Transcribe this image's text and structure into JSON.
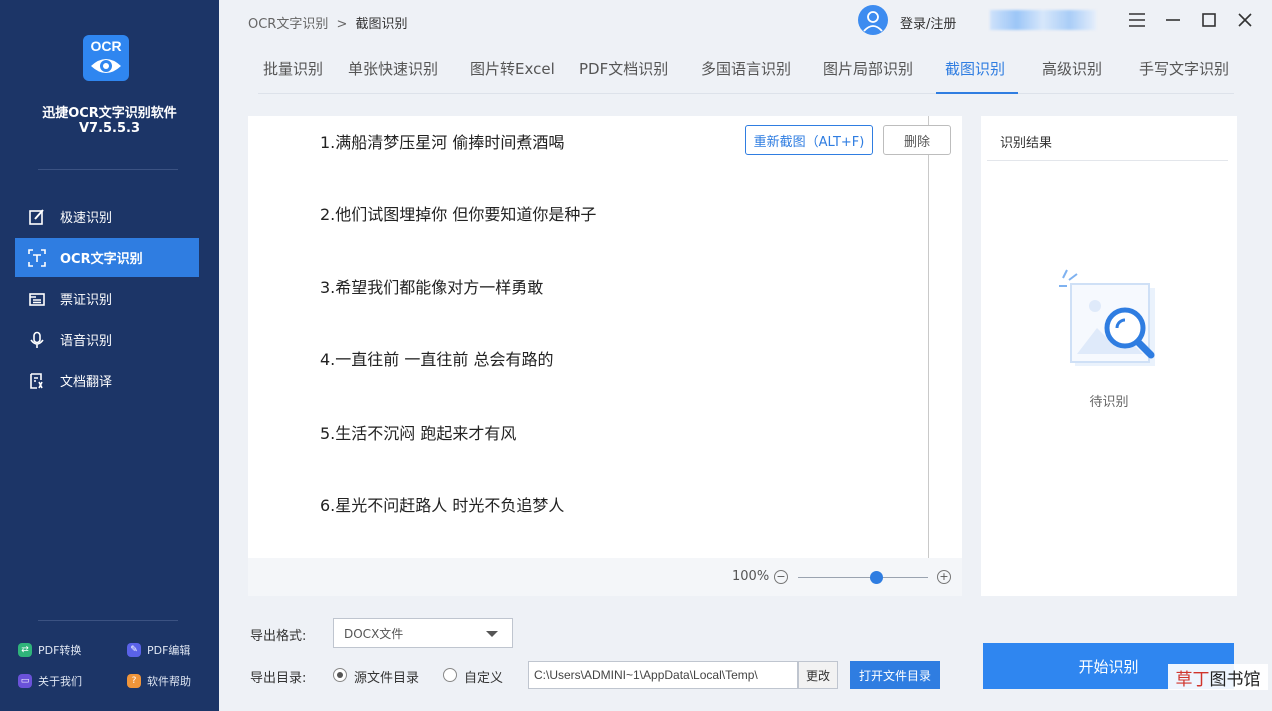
{
  "app": {
    "logo_text": "OCR",
    "name": "迅捷OCR文字识别软件",
    "version": "V7.5.5.3"
  },
  "sidebar": {
    "items": [
      {
        "label": "极速识别",
        "icon": "edit-icon"
      },
      {
        "label": "OCR文字识别",
        "icon": "scan-icon",
        "active": true
      },
      {
        "label": "票证识别",
        "icon": "id-card-icon"
      },
      {
        "label": "语音识别",
        "icon": "microphone-icon"
      },
      {
        "label": "文档翻译",
        "icon": "translate-icon"
      }
    ],
    "footer": [
      {
        "label": "PDF转换",
        "icon": "pdf-convert-icon",
        "color": "#2fb47a"
      },
      {
        "label": "PDF编辑",
        "icon": "pdf-edit-icon",
        "color": "#5a62e8"
      },
      {
        "label": "关于我们",
        "icon": "about-icon",
        "color": "#6a52d9"
      },
      {
        "label": "软件帮助",
        "icon": "help-icon",
        "color": "#f0953a"
      }
    ]
  },
  "breadcrumb": {
    "parent": "OCR文字识别",
    "separator": ">",
    "current": "截图识别"
  },
  "header": {
    "login_label": "登录/注册"
  },
  "tabs": [
    {
      "label": "批量识别"
    },
    {
      "label": "单张快速识别"
    },
    {
      "label": "图片转Excel"
    },
    {
      "label": "PDF文档识别"
    },
    {
      "label": "多国语言识别"
    },
    {
      "label": "图片局部识别"
    },
    {
      "label": "截图识别",
      "active": true
    },
    {
      "label": "高级识别"
    },
    {
      "label": "手写文字识别"
    }
  ],
  "image_panel": {
    "lines": [
      "1.满船清梦压星河 偷捧时间煮酒喝",
      "2.他们试图埋掉你 但你要知道你是种子",
      "3.希望我们都能像对方一样勇敢",
      "4.一直往前 一直往前 总会有路的",
      "5.生活不沉闷 跑起来才有风",
      "6.星光不问赶路人 时光不负追梦人"
    ],
    "recapture_label": "重新截图（ALT+F)",
    "delete_label": "删除",
    "zoom": "100%",
    "zoom_level": 0.6
  },
  "result_panel": {
    "title": "识别结果",
    "status": "待识别"
  },
  "export": {
    "format_label": "导出格式:",
    "format_value": "DOCX文件",
    "dir_label": "导出目录:",
    "radio_source": "源文件目录",
    "radio_custom": "自定义",
    "path": "C:\\Users\\ADMINI~1\\AppData\\Local\\Temp\\",
    "change_label": "更改",
    "open_dir_label": "打开文件目录"
  },
  "start_label": "开始识别",
  "watermark": {
    "part1": "草丁",
    "part2": "图书馆"
  },
  "colors": {
    "sidebar_bg": "#1c3567",
    "accent": "#2f7de1"
  }
}
